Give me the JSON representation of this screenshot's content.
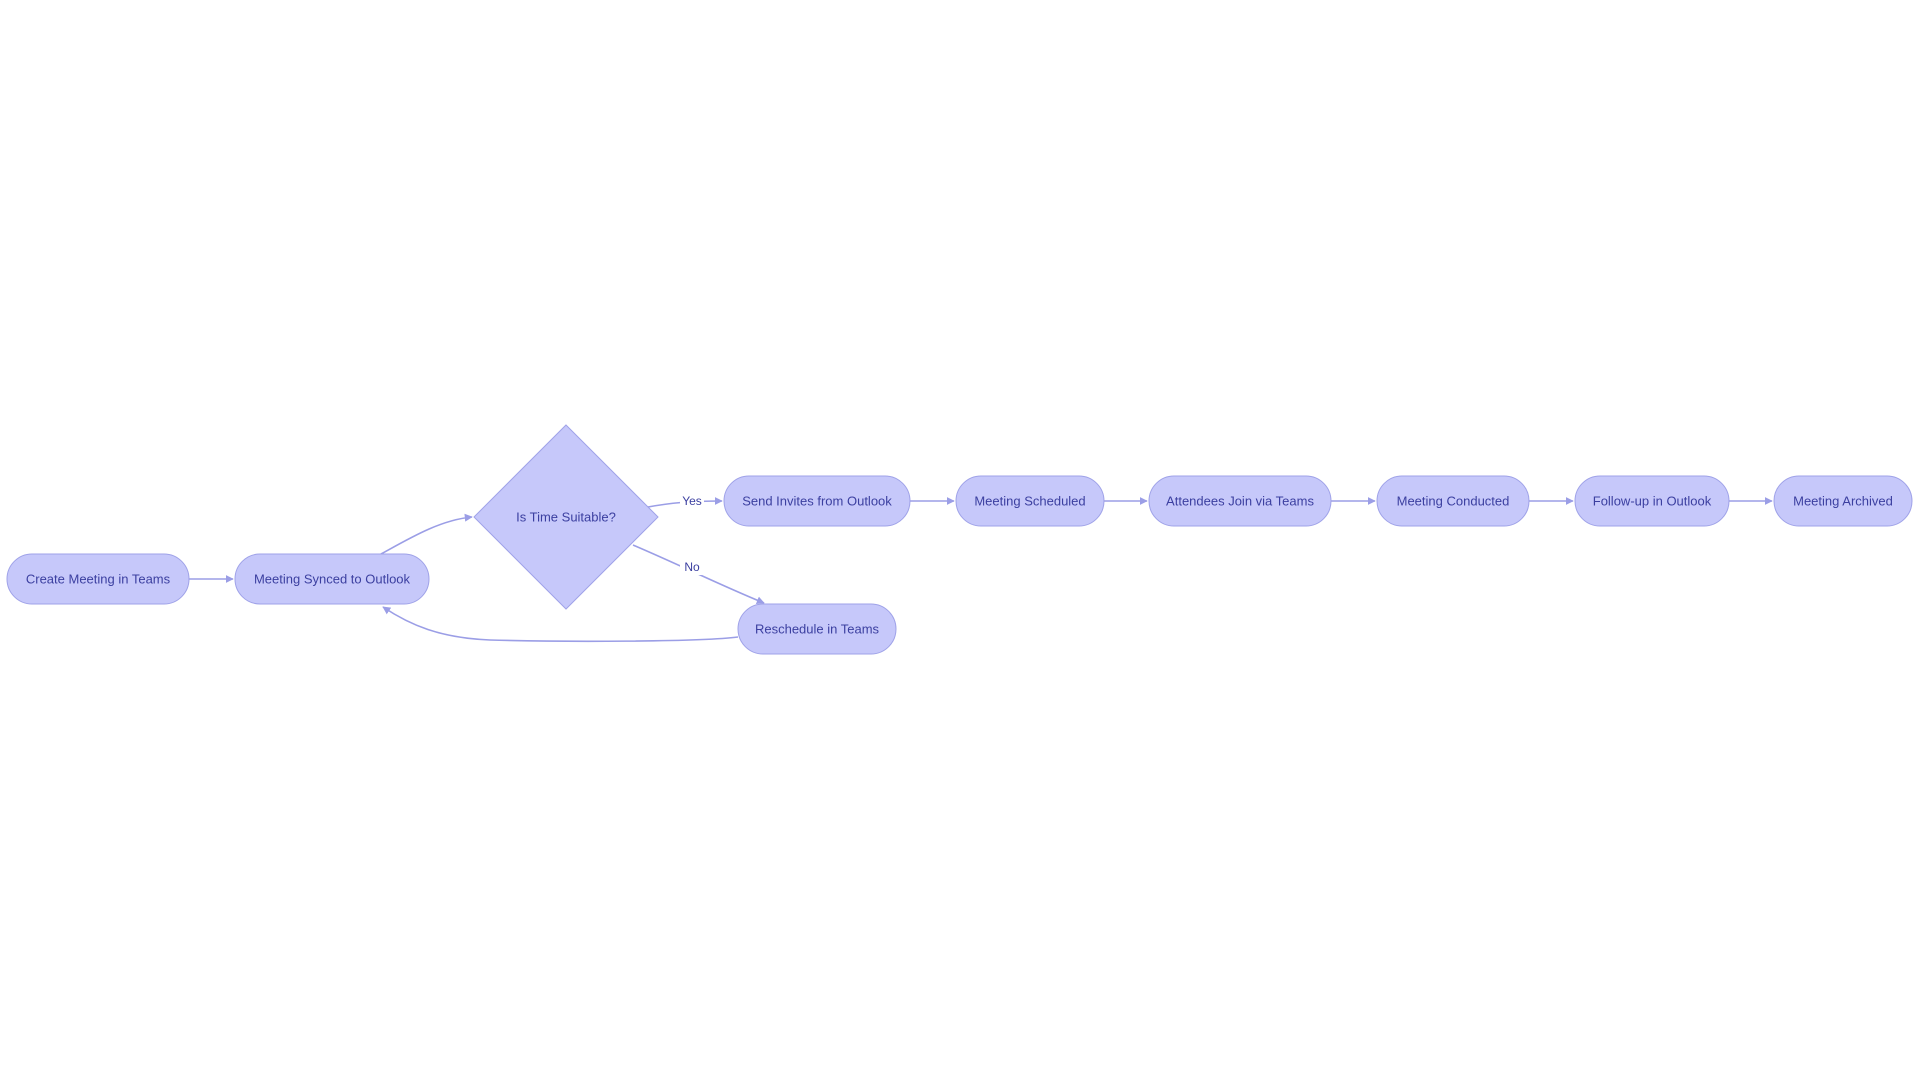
{
  "diagram": {
    "type": "flowchart",
    "direction": "left-to-right",
    "colors": {
      "node_fill": "#c6c8fa",
      "node_stroke": "#9fa2e8",
      "edge": "#9b9ee6",
      "text": "#3b3fa0",
      "background": "#ffffff"
    },
    "nodes": [
      {
        "id": "A",
        "label": "Create Meeting in Teams",
        "shape": "stadium"
      },
      {
        "id": "B",
        "label": "Meeting Synced to Outlook",
        "shape": "stadium"
      },
      {
        "id": "C",
        "label": "Is Time Suitable?",
        "shape": "diamond"
      },
      {
        "id": "D",
        "label": "Send Invites from Outlook",
        "shape": "stadium"
      },
      {
        "id": "E",
        "label": "Reschedule in Teams",
        "shape": "stadium"
      },
      {
        "id": "F",
        "label": "Meeting Scheduled",
        "shape": "stadium"
      },
      {
        "id": "G",
        "label": "Attendees Join via Teams",
        "shape": "stadium"
      },
      {
        "id": "H",
        "label": "Meeting Conducted",
        "shape": "stadium"
      },
      {
        "id": "I",
        "label": "Follow-up in Outlook",
        "shape": "stadium"
      },
      {
        "id": "J",
        "label": "Meeting Archived",
        "shape": "stadium"
      }
    ],
    "edges": [
      {
        "from": "A",
        "to": "B",
        "label": ""
      },
      {
        "from": "B",
        "to": "C",
        "label": ""
      },
      {
        "from": "C",
        "to": "D",
        "label": "Yes"
      },
      {
        "from": "C",
        "to": "E",
        "label": "No"
      },
      {
        "from": "E",
        "to": "B",
        "label": ""
      },
      {
        "from": "D",
        "to": "F",
        "label": ""
      },
      {
        "from": "F",
        "to": "G",
        "label": ""
      },
      {
        "from": "G",
        "to": "H",
        "label": ""
      },
      {
        "from": "H",
        "to": "I",
        "label": ""
      },
      {
        "from": "I",
        "to": "J",
        "label": ""
      }
    ]
  }
}
